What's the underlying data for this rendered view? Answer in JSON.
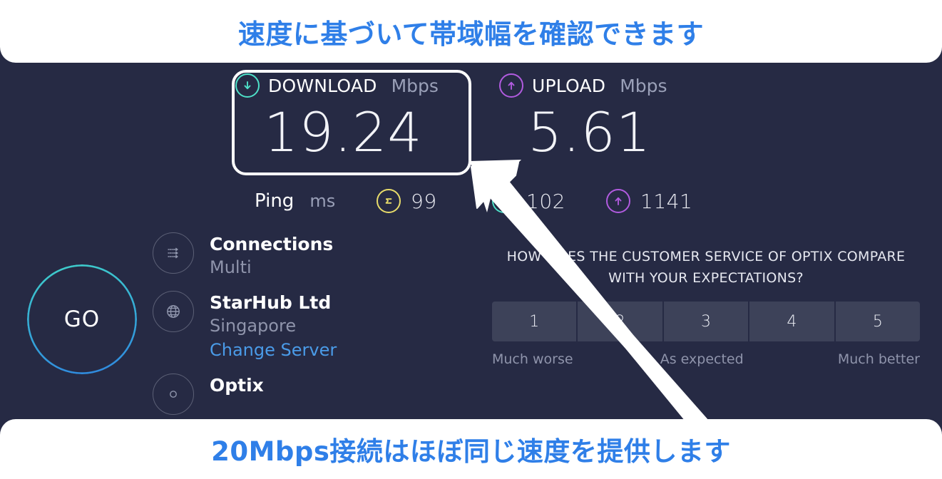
{
  "banners": {
    "top": "速度に基づいて帯域幅を確認できます",
    "bottom": "20Mbps接続はほぼ同じ速度を提供します",
    "text_color": "#2f7fe8"
  },
  "speedtest": {
    "download": {
      "label": "DOWNLOAD",
      "unit": "Mbps",
      "value": "19.24",
      "icon": "arrow-down-circle-icon",
      "color": "#4ee0c8",
      "highlighted": true
    },
    "upload": {
      "label": "UPLOAD",
      "unit": "Mbps",
      "value": "5.61",
      "icon": "arrow-up-circle-icon",
      "color": "#b15bdf"
    },
    "ping": {
      "label": "Ping",
      "unit": "ms",
      "idle_value": "99",
      "idle_icon": "latency-idle-icon",
      "idle_color": "#e8dc6a",
      "download_value": "102",
      "download_icon": "arrow-down-circle-icon",
      "upload_value": "1141",
      "upload_icon": "arrow-up-circle-icon"
    },
    "go_button": {
      "label": "GO",
      "ring_from": "#3fd0c9",
      "ring_to": "#2f86df"
    },
    "info": [
      {
        "icon": "multi-connection-icon",
        "title": "Connections",
        "sub": "Multi"
      },
      {
        "icon": "globe-icon",
        "title": "StarHub Ltd",
        "sub": "Singapore",
        "link": "Change Server"
      },
      {
        "icon": "provider-icon",
        "title": "Optix"
      }
    ]
  },
  "survey": {
    "question": "HOW DOES THE CUSTOMER SERVICE OF OPTIX COMPARE WITH YOUR EXPECTATIONS?",
    "options": [
      "1",
      "2",
      "3",
      "4",
      "5"
    ],
    "legend_low": "Much worse",
    "legend_mid": "As expected",
    "legend_high": "Much better"
  },
  "annotation": {
    "cursor": "pointer-arrow-cursor"
  },
  "theme": {
    "background": "#262a44",
    "rating_cell": "#3d4259"
  }
}
